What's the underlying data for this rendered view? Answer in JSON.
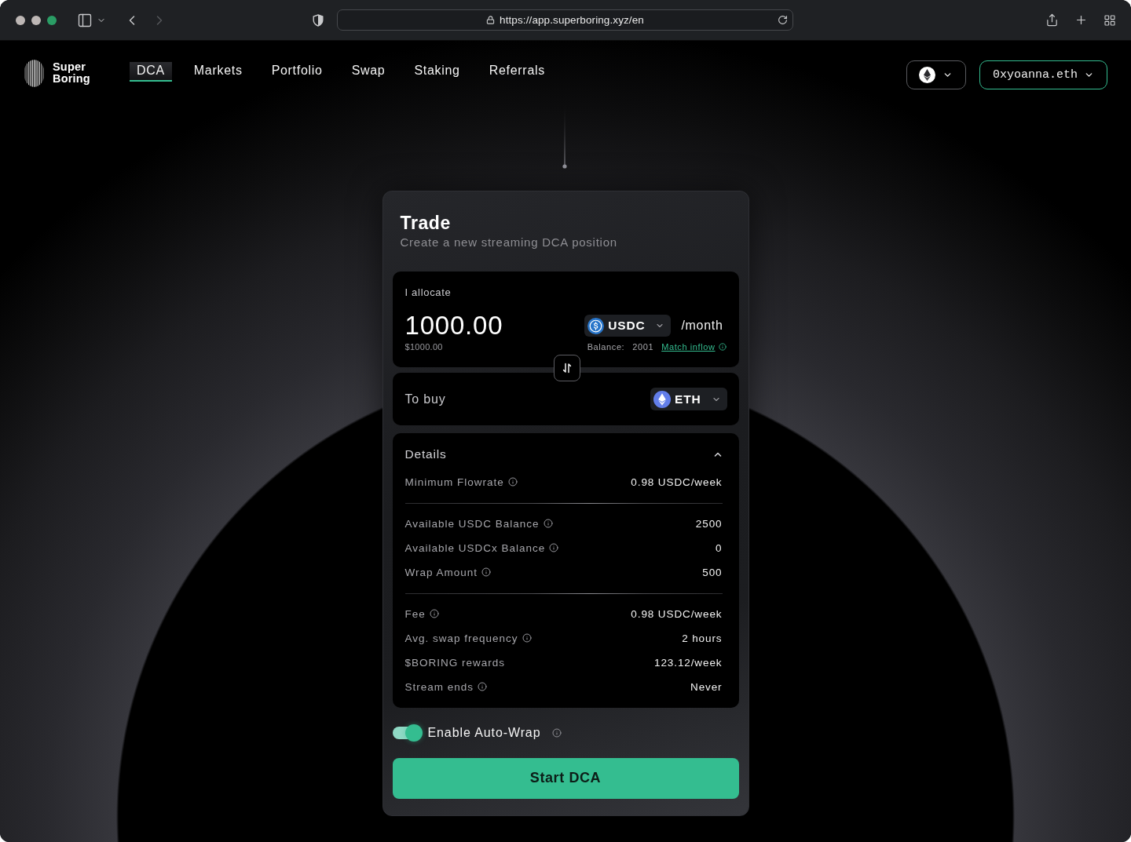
{
  "browser": {
    "url": "https://app.superboring.xyz/en",
    "can_go_forward": false
  },
  "brand": {
    "line_1": "Super",
    "line_2": "Boring"
  },
  "nav": [
    {
      "label": "DCA",
      "selected": true
    },
    {
      "label": "Markets",
      "selected": false
    },
    {
      "label": "Portfolio",
      "selected": false
    },
    {
      "label": "Swap",
      "selected": false
    },
    {
      "label": "Staking",
      "selected": false
    },
    {
      "label": "Referrals",
      "selected": false
    }
  ],
  "wallet": {
    "label": "0xyoanna.eth"
  },
  "trade": {
    "title": "Trade",
    "subtitle": "Create a new streaming DCA position",
    "allocate": {
      "label": "I allocate",
      "amount": "1000.00",
      "usd_value": "$1000.00",
      "token": "USDC",
      "period": "/month",
      "balance_label": "Balance:",
      "balance": "2001",
      "match_link": "Match inflow"
    },
    "buy": {
      "label": "To buy",
      "token": "ETH"
    },
    "details": {
      "title": "Details",
      "expanded": true,
      "groups": [
        {
          "rows": [
            {
              "label": "Minimum Flowrate",
              "info": true,
              "value": "0.98 USDC/week"
            }
          ]
        },
        {
          "rows": [
            {
              "label": "Available USDC Balance",
              "info": true,
              "value": "2500"
            },
            {
              "label": "Available USDCx Balance",
              "info": true,
              "value": "0"
            },
            {
              "label": "Wrap Amount",
              "info": true,
              "value": "500"
            }
          ]
        },
        {
          "rows": [
            {
              "label": "Fee",
              "info": true,
              "value": "0.98 USDC/week"
            },
            {
              "label": "Avg. swap frequency",
              "info": true,
              "value": "2 hours"
            },
            {
              "label": "$BORING rewards",
              "info": false,
              "value": "123.12/week"
            },
            {
              "label": "Stream ends",
              "info": true,
              "value": "Never"
            }
          ]
        }
      ]
    },
    "auto_wrap": {
      "label": "Enable Auto-Wrap",
      "on": true
    },
    "submit": "Start DCA"
  }
}
